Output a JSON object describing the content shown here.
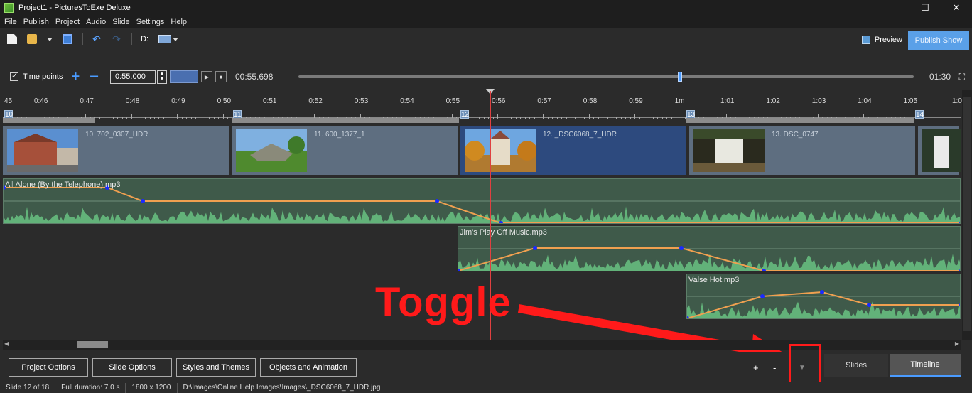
{
  "window": {
    "title": "Project1 - PicturesToExe Deluxe",
    "min": "—",
    "max": "☐",
    "close": "✕"
  },
  "menu": [
    "File",
    "Publish",
    "Project",
    "Audio",
    "Slide",
    "Settings",
    "Help"
  ],
  "toolbar": {
    "drive_label": "D:",
    "preview_label": "Preview",
    "publish_label": "Publish Show"
  },
  "timepoints": {
    "label": "Time points",
    "checked": true,
    "value": "0:55.000",
    "current_time": "00:55.698",
    "end_time": "01:30",
    "position_fraction": 0.62
  },
  "ruler": {
    "ticks": [
      "0:46",
      "0:47",
      "0:48",
      "0:49",
      "0:50",
      "0:51",
      "0:52",
      "0:53",
      "0:54",
      "0:55",
      "0:56",
      "0:57",
      "0:58",
      "0:59",
      "1m",
      "1:01",
      "1:02",
      "1:03",
      "1:04",
      "1:05"
    ],
    "edge_left": "45",
    "edge_right": "1:0",
    "slide_markers": [
      "10",
      "11",
      "12",
      "13",
      "14"
    ]
  },
  "slides": [
    {
      "name": "10. 702_0307_HDR",
      "selected": false,
      "thumb": "brick-house"
    },
    {
      "name": "11. 600_1377_1",
      "selected": false,
      "thumb": "dolmen"
    },
    {
      "name": "12. _DSC6068_7_HDR",
      "selected": true,
      "thumb": "castle"
    },
    {
      "name": "13. DSC_0747",
      "selected": false,
      "thumb": "waterfall"
    },
    {
      "name": "",
      "selected": false,
      "thumb": "waterfall-2"
    }
  ],
  "audio_tracks": [
    {
      "name": "All Alone (By the Telephone).mp3"
    },
    {
      "name": "Jim's Play Off Music.mp3"
    },
    {
      "name": "Valse Hot.mp3"
    }
  ],
  "annotation": {
    "text": "Toggle"
  },
  "bottom": {
    "buttons": [
      "Project Options",
      "Slide Options",
      "Styles and Themes",
      "Objects and Animation"
    ],
    "zoom_plus": "+",
    "zoom_minus": "-",
    "toggle": "▼",
    "tab_slides": "Slides",
    "tab_timeline": "Timeline"
  },
  "status": [
    "Slide 12 of 18",
    "Full duration: 7.0 s",
    "1800 x 1200",
    "D:\\Images\\Online Help Images\\Images\\_DSC6068_7_HDR.jpg"
  ],
  "colors": {
    "accent": "#4a9bff",
    "playhead": "#e04040",
    "annotation": "#ff1a1a",
    "waveform": "#6fd08a",
    "envelope": "#f0a050"
  }
}
